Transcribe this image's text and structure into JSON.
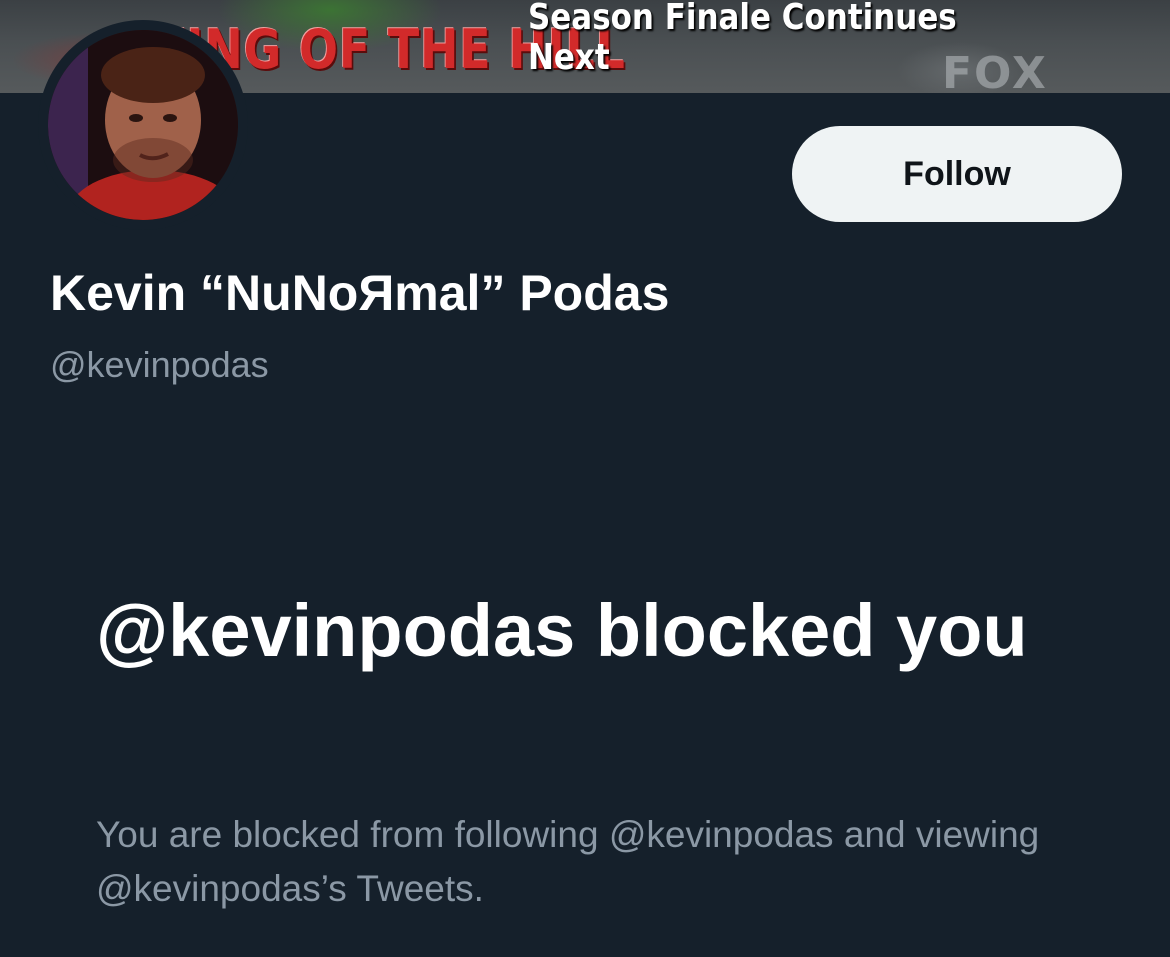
{
  "banner": {
    "show_logo_text": "KING OF THE HILL",
    "caption_line1": "Season Finale Continues",
    "caption_line2": "Next",
    "network_logo_text": "FOX"
  },
  "profile": {
    "display_name": "Kevin “NuNoЯmal” Podas",
    "handle": "@kevinpodas",
    "follow_label": "Follow"
  },
  "blocked_notice": {
    "title": "@kevinpodas blocked you",
    "description": "You are blocked from following @kevinpodas and viewing @kevinpodas’s Tweets."
  },
  "colors": {
    "background": "#15202b",
    "primary_text": "#ffffff",
    "secondary_text": "#8b98a5",
    "follow_button_bg": "#eff3f4",
    "follow_button_text": "#0f1419"
  }
}
